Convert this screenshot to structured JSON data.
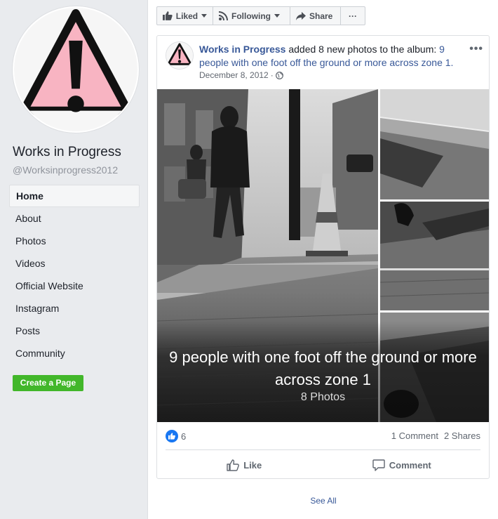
{
  "left": {
    "page_name": "Works in Progress",
    "page_handle": "@Worksinprogress2012",
    "nav": [
      {
        "label": "Home",
        "active": true
      },
      {
        "label": "About"
      },
      {
        "label": "Photos"
      },
      {
        "label": "Videos"
      },
      {
        "label": "Official Website"
      },
      {
        "label": "Instagram"
      },
      {
        "label": "Posts"
      },
      {
        "label": "Community"
      }
    ],
    "create_page_label": "Create a Page"
  },
  "toolbar": {
    "liked_label": "Liked",
    "following_label": "Following",
    "share_label": "Share",
    "more_label": "···"
  },
  "post": {
    "page_name": "Works in Progress",
    "action_text": " added 8 new photos to the album: ",
    "album_name": "9 people with one foot off the ground or more across zone 1.",
    "date": "December 8, 2012",
    "date_separator": "·",
    "more_label": "•••",
    "album_title": "9 people with one foot off the ground or more across zone 1",
    "photo_count": "8 Photos",
    "like_count": "6",
    "comments": "1 Comment",
    "shares": "2 Shares",
    "like_button": "Like",
    "comment_button": "Comment"
  },
  "see_all_label": "See All",
  "colors": {
    "link": "#385898",
    "create_button": "#42b72a",
    "avatar_pink": "#f8b4c2",
    "like_blue": "#1877f2"
  }
}
